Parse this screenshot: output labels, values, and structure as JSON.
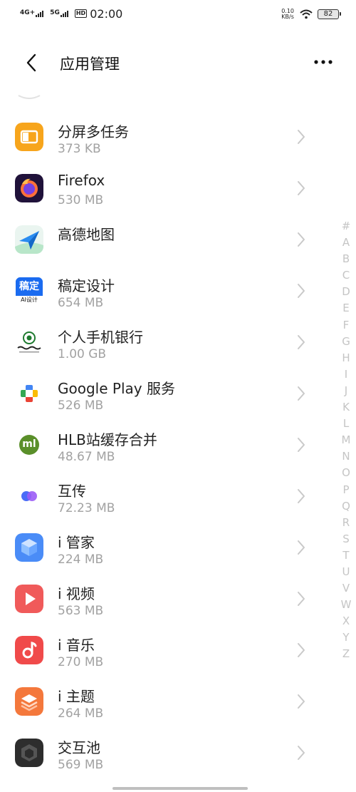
{
  "status_bar": {
    "sim1_label": "4G+",
    "sim2_label": "5G",
    "hd_label": "HD",
    "time": "02:00",
    "net_speed_value": "0.10",
    "net_speed_unit": "KB/s",
    "battery_level": "82"
  },
  "header": {
    "back_icon": "chevron-left-icon",
    "title": "应用管理",
    "more_icon": "more-horizontal-icon"
  },
  "apps": [
    {
      "name": "分屏多任务",
      "size": "373 KB",
      "icon": "split-screen-icon",
      "color": "#f7a51c"
    },
    {
      "name": "Firefox",
      "size": "530 MB",
      "icon": "firefox-icon",
      "color": "#20123a"
    },
    {
      "name": "高德地图",
      "size": "",
      "icon": "amap-icon",
      "color": "#2a8cf0"
    },
    {
      "name": "稿定设计",
      "size": "654 MB",
      "icon": "gaoding-icon",
      "color": "#1a6bf0",
      "icon_text": "稿定",
      "icon_subtext": "AI设计"
    },
    {
      "name": "个人手机银行",
      "size": "1.00 GB",
      "icon": "bank-icon",
      "color": "#1e7a2f"
    },
    {
      "name": "Google Play 服务",
      "size": "526 MB",
      "icon": "google-play-services-icon",
      "color": "#4285f4"
    },
    {
      "name": "HLB站缓存合并",
      "size": "48.67 MB",
      "icon": "hlb-merge-icon",
      "color": "#5a8f2a",
      "icon_text": "ml"
    },
    {
      "name": "互传",
      "size": "72.23 MB",
      "icon": "easyshare-icon",
      "color": "#4a6cf7"
    },
    {
      "name": "i 管家",
      "size": "224 MB",
      "icon": "imanager-icon",
      "color": "#4a8cf7"
    },
    {
      "name": "i 视频",
      "size": "563 MB",
      "icon": "ivideo-icon",
      "color": "#f05a5a"
    },
    {
      "name": "i 音乐",
      "size": "270 MB",
      "icon": "imusic-icon",
      "color": "#f04a4a"
    },
    {
      "name": "i 主题",
      "size": "264 MB",
      "icon": "itheme-icon",
      "color": "#f4783c"
    },
    {
      "name": "交互池",
      "size": "569 MB",
      "icon": "interaction-pool-icon",
      "color": "#2d2d2d"
    }
  ],
  "index_letters": [
    "#",
    "A",
    "B",
    "C",
    "D",
    "E",
    "F",
    "G",
    "H",
    "I",
    "J",
    "K",
    "L",
    "M",
    "N",
    "O",
    "P",
    "Q",
    "R",
    "S",
    "T",
    "U",
    "V",
    "W",
    "X",
    "Y",
    "Z"
  ]
}
